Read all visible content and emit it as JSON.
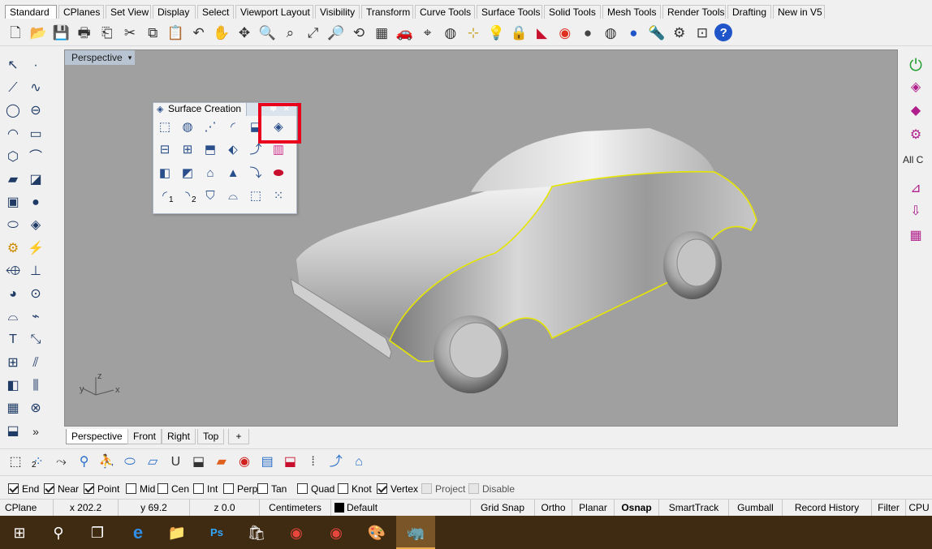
{
  "tabs": [
    "Standard",
    "CPlanes",
    "Set View",
    "Display",
    "Select",
    "Viewport Layout",
    "Visibility",
    "Transform",
    "Curve Tools",
    "Surface Tools",
    "Solid Tools",
    "Mesh Tools",
    "Render Tools",
    "Drafting",
    "New in V5"
  ],
  "active_tab": "Standard",
  "main_toolbar_icons": [
    {
      "name": "new-file-icon",
      "glyph": "🗋"
    },
    {
      "name": "open-folder-icon",
      "glyph": "📂"
    },
    {
      "name": "save-icon",
      "glyph": "💾"
    },
    {
      "name": "print-icon",
      "glyph": "🖶"
    },
    {
      "name": "import-icon",
      "glyph": "⎗"
    },
    {
      "name": "cut-icon",
      "glyph": "✂"
    },
    {
      "name": "copy-icon",
      "glyph": "⧉"
    },
    {
      "name": "paste-icon",
      "glyph": "📋"
    },
    {
      "name": "undo-icon",
      "glyph": "↶"
    },
    {
      "name": "pan-hand-icon",
      "glyph": "✋"
    },
    {
      "name": "rotate-view-icon",
      "glyph": "✥"
    },
    {
      "name": "zoom-icon",
      "glyph": "🔍"
    },
    {
      "name": "zoom-window-icon",
      "glyph": "⌕"
    },
    {
      "name": "zoom-extents-icon",
      "glyph": "⤢"
    },
    {
      "name": "zoom-selected-icon",
      "glyph": "🔎"
    },
    {
      "name": "undo-view-icon",
      "glyph": "⟲"
    },
    {
      "name": "four-viewports-icon",
      "glyph": "▦"
    },
    {
      "name": "car-icon",
      "glyph": "🚗"
    },
    {
      "name": "named-views-icon",
      "glyph": "⌖"
    },
    {
      "name": "cplane-icon",
      "glyph": "◍"
    },
    {
      "name": "osnap-settings-icon",
      "glyph": "⊹"
    },
    {
      "name": "lightbulb-icon",
      "glyph": "💡"
    },
    {
      "name": "lock-icon",
      "glyph": "🔒"
    },
    {
      "name": "layer-icon",
      "glyph": "◣"
    },
    {
      "name": "color-wheel-icon",
      "glyph": "◉"
    },
    {
      "name": "shaded-sphere-icon",
      "glyph": "●"
    },
    {
      "name": "rendered-sphere-icon",
      "glyph": "◍"
    },
    {
      "name": "blue-sphere-icon",
      "glyph": "●"
    },
    {
      "name": "render-icon",
      "glyph": "🔦"
    },
    {
      "name": "options-gear-icon",
      "glyph": "⚙"
    },
    {
      "name": "group-icon",
      "glyph": "⊡"
    },
    {
      "name": "help-icon",
      "glyph": "?"
    }
  ],
  "left_toolbar_icons": [
    "select-arrow-icon",
    "point-icon",
    "polyline-icon",
    "curve-points-icon",
    "circle-icon",
    "ellipse-icon",
    "arc-icon",
    "rectangle-icon",
    "polygon-icon",
    "curve-fillet-icon",
    "surface-icon",
    "extrude-icon",
    "box-icon",
    "sphere-icon",
    "cylinder-icon",
    "mesh-icon",
    "solid-tools-icon",
    "lightning-icon",
    "trim-icon",
    "split-icon",
    "boolean-icon",
    "join-icon",
    "fillet-icon",
    "offset-icon",
    "text-icon",
    "dimension-icon",
    "group-icon",
    "transform-icon",
    "block-icon",
    "array-icon",
    "grid-array-icon",
    "history-icon",
    "render-icon",
    "more-icon"
  ],
  "viewport": {
    "title": "Perspective",
    "dropdown": "▾",
    "axis_x": "x",
    "axis_y": "y",
    "axis_z": "z",
    "view_tabs": [
      "Perspective",
      "Front",
      "Right",
      "Top"
    ],
    "active_view_tab": "Perspective",
    "add_tab": "+"
  },
  "panel": {
    "title": "Surface Creation",
    "close": "×",
    "gear": "✽",
    "highlight_color": "#e8001c",
    "rows": [
      [
        "corner-points-surface-icon",
        "sphere-surface-icon",
        "network-surface-icon",
        "sweep-rail-icon",
        "sweep-icon",
        "loft-highlighted-icon"
      ],
      [
        "planar-surface-icon",
        "edge-surface-icon",
        "extrude-surface-icon",
        "patch-icon",
        "revolve-icon",
        "rainbow-surface-icon"
      ],
      [
        "extrude-curve-icon",
        "extrude-straight-icon",
        "extrude-tapered-icon",
        "cone-surface-icon",
        "rail-revolve-icon",
        "drape-icon"
      ],
      [
        "sweep-1-rail-icon",
        "sweep-2-rails-icon",
        "heightfield-icon",
        "surface-from-curves-icon",
        "point-grid-surface-icon",
        "dot-grid-icon"
      ]
    ],
    "sweep_label_1": "1",
    "sweep_label_2": "2"
  },
  "right_toolbar_icons": [
    "power-icon",
    "cube-mesh-icon",
    "pink-surface-icon",
    "gear-pink-icon",
    "all-c-label",
    "pink-dimension-icon",
    "pink-arrow-icon",
    "pink-grid-icon"
  ],
  "right_toolbar_label": "All C",
  "bottom_toolbar_icons": [
    {
      "name": "points-curve-icon",
      "sub": "2"
    },
    {
      "name": "points-cloud-icon",
      "sub": ""
    },
    {
      "name": "blend-icon",
      "sub": ""
    },
    {
      "name": "person-icon",
      "sub": ""
    },
    {
      "name": "cylinder-mesh-icon",
      "sub": ""
    },
    {
      "name": "flat-surface-icon",
      "sub": ""
    },
    {
      "name": "u-icon",
      "sub": ""
    },
    {
      "name": "box-mesh-icon",
      "sub": ""
    },
    {
      "name": "rainbow-analysis-icon",
      "sub": ""
    },
    {
      "name": "zebra-icon",
      "sub": ""
    },
    {
      "name": "blue-sheet-icon",
      "sub": ""
    },
    {
      "name": "red-box-icon",
      "sub": ""
    },
    {
      "name": "control-points-icon",
      "sub": ""
    },
    {
      "name": "sweep-curve-icon",
      "sub": ""
    },
    {
      "name": "taper-icon",
      "sub": ""
    },
    {
      "name": "curve-deform-icon",
      "sub": ""
    }
  ],
  "osnaps": [
    {
      "label": "End",
      "checked": true,
      "enabled": true
    },
    {
      "label": "Near",
      "checked": true,
      "enabled": true
    },
    {
      "label": "Point",
      "checked": true,
      "enabled": true
    },
    {
      "label": "Mid",
      "checked": false,
      "enabled": true
    },
    {
      "label": "Cen",
      "checked": false,
      "enabled": true
    },
    {
      "label": "Int",
      "checked": false,
      "enabled": true
    },
    {
      "label": "Perp",
      "checked": false,
      "enabled": true
    },
    {
      "label": "Tan",
      "checked": false,
      "enabled": true
    },
    {
      "label": "Quad",
      "checked": false,
      "enabled": true
    },
    {
      "label": "Knot",
      "checked": false,
      "enabled": true
    },
    {
      "label": "Vertex",
      "checked": true,
      "enabled": true
    },
    {
      "label": "Project",
      "checked": false,
      "enabled": false
    },
    {
      "label": "Disable",
      "checked": false,
      "enabled": false
    }
  ],
  "status": {
    "cplane": "CPlane",
    "x": "x 202.2",
    "y": "y 69.2",
    "z": "z 0.0",
    "units": "Centimeters",
    "layer": "Default",
    "layer_color": "#000000",
    "grid_snap": "Grid Snap",
    "ortho": "Ortho",
    "planar": "Planar",
    "osnap": "Osnap",
    "smarttrack": "SmartTrack",
    "gumball": "Gumball",
    "record_history": "Record History",
    "filter": "Filter",
    "cpu": "CPU"
  },
  "taskbar": [
    {
      "name": "start-windows-icon",
      "glyph": "⊞"
    },
    {
      "name": "search-icon",
      "glyph": "⚲"
    },
    {
      "name": "task-view-icon",
      "glyph": "❐"
    },
    {
      "name": "edge-browser-icon",
      "glyph": "e"
    },
    {
      "name": "file-explorer-icon",
      "glyph": "📁"
    },
    {
      "name": "photoshop-icon",
      "glyph": "Ps"
    },
    {
      "name": "store-icon",
      "glyph": "🛍"
    },
    {
      "name": "chrome-icon",
      "glyph": "◉"
    },
    {
      "name": "chrome-alt-icon",
      "glyph": "◉"
    },
    {
      "name": "paint-icon",
      "glyph": "🎨"
    },
    {
      "name": "rhino-icon",
      "glyph": "🦏"
    }
  ],
  "colors": {
    "viewport_bg": "#a0a0a0",
    "selection_outline": "#e6e600",
    "taskbar": "#3f2a12",
    "title_bar": "#b8c4d2"
  }
}
